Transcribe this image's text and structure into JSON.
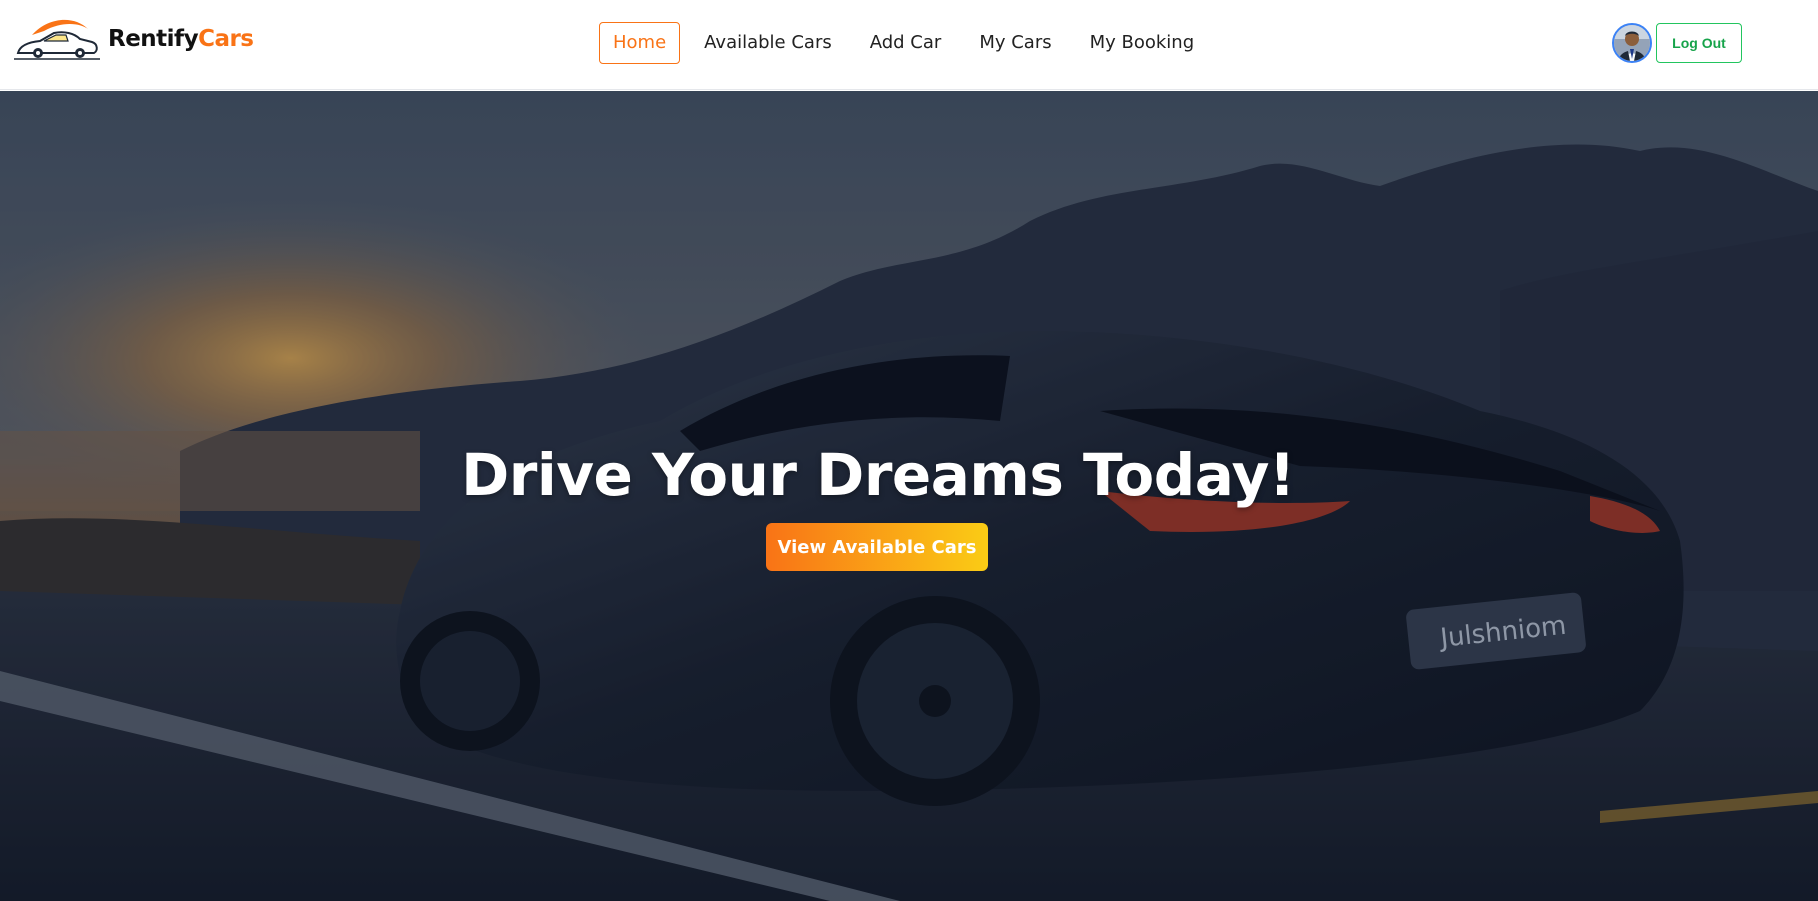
{
  "brand": {
    "name_primary": "Rentify",
    "name_accent": "Cars",
    "logo_icon": "car-logo-icon"
  },
  "nav": {
    "items": [
      {
        "label": "Home",
        "active": true
      },
      {
        "label": "Available Cars",
        "active": false
      },
      {
        "label": "Add Car",
        "active": false
      },
      {
        "label": "My Cars",
        "active": false
      },
      {
        "label": "My Booking",
        "active": false
      }
    ]
  },
  "user": {
    "avatar_icon": "user-avatar",
    "logout_label": "Log Out"
  },
  "hero": {
    "title": "Drive Your Dreams Today!",
    "cta_label": "View Available Cars",
    "plate_text": "Julshniom"
  },
  "colors": {
    "accent": "#f97316",
    "accent_gradient_end": "#facc15",
    "logout_green": "#16a34a",
    "avatar_ring": "#3b82f6"
  }
}
